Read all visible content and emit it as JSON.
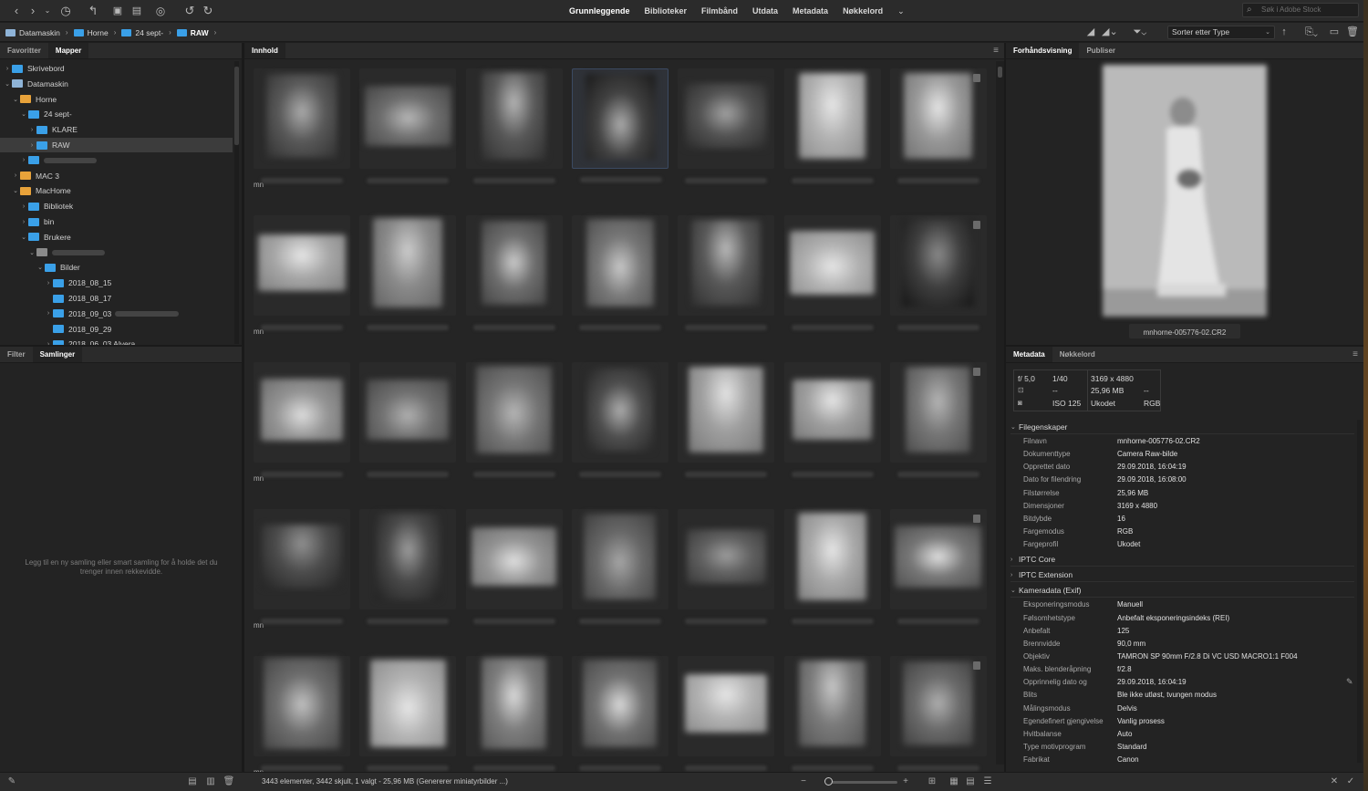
{
  "topbar": {
    "workspaces": [
      "Grunnleggende",
      "Biblioteker",
      "Filmbånd",
      "Utdata",
      "Metadata",
      "Nøkkelord"
    ],
    "active_workspace": "Grunnleggende",
    "search_placeholder": "Søk i Adobe Stock"
  },
  "pathbar": {
    "crumbs": [
      {
        "label": "Datamaskin",
        "icon": "computer-icon"
      },
      {
        "label": "Horne",
        "icon": "folder-icon"
      },
      {
        "label": "24 sept-",
        "icon": "folder-icon"
      },
      {
        "label": "RAW",
        "icon": "folder-icon"
      }
    ],
    "sort_label": "Sorter etter Type"
  },
  "folders_panel": {
    "tabs": [
      "Favoritter",
      "Mapper"
    ],
    "active_tab": "Mapper",
    "tree": [
      {
        "label": "Skrivebord",
        "level": 0,
        "icon": "folder-icon",
        "arrow": "right"
      },
      {
        "label": "Datamaskin",
        "level": 0,
        "icon": "computer-icon",
        "arrow": "down"
      },
      {
        "label": "Horne",
        "level": 1,
        "icon": "drive-icon",
        "arrow": "down"
      },
      {
        "label": "24 sept-",
        "level": 2,
        "icon": "folder-icon",
        "arrow": "down"
      },
      {
        "label": "KLARE",
        "level": 3,
        "icon": "folder-icon",
        "arrow": "right"
      },
      {
        "label": "RAW",
        "level": 3,
        "icon": "folder-icon",
        "arrow": "right",
        "selected": true
      },
      {
        "label": "",
        "level": 2,
        "icon": "folder-icon",
        "arrow": "right",
        "redacted": true
      },
      {
        "label": "MAC 3",
        "level": 1,
        "icon": "drive-icon",
        "arrow": "right"
      },
      {
        "label": "MacHome",
        "level": 1,
        "icon": "drive-icon",
        "arrow": "down"
      },
      {
        "label": "Bibliotek",
        "level": 2,
        "icon": "folder-icon",
        "arrow": "right"
      },
      {
        "label": "bin",
        "level": 2,
        "icon": "folder-icon",
        "arrow": "right"
      },
      {
        "label": "Brukere",
        "level": 2,
        "icon": "folder-icon",
        "arrow": "down"
      },
      {
        "label": "",
        "level": 3,
        "icon": "home-icon",
        "arrow": "down",
        "redacted": true
      },
      {
        "label": "Bilder",
        "level": 4,
        "icon": "folder-icon",
        "arrow": "down"
      },
      {
        "label": "2018_08_15",
        "level": 5,
        "icon": "folder-icon",
        "arrow": "right"
      },
      {
        "label": "2018_08_17",
        "level": 5,
        "icon": "folder-icon",
        "arrow": ""
      },
      {
        "label": "2018_09_03",
        "level": 5,
        "icon": "folder-icon",
        "arrow": "right",
        "redact_after": true
      },
      {
        "label": "2018_09_29",
        "level": 5,
        "icon": "folder-icon",
        "arrow": ""
      },
      {
        "label": "2018_06_03 Alvera",
        "level": 5,
        "icon": "folder-icon",
        "arrow": "right"
      }
    ]
  },
  "collections_panel": {
    "tabs": [
      "Filter",
      "Samlinger"
    ],
    "active_tab": "Samlinger",
    "empty_message": "Legg til en ny samling eller smart samling for å holde det du trenger innen rekkevidde."
  },
  "content_panel": {
    "tab": "Innhold",
    "row_prefix": "mn",
    "status": "3443 elementer, 3442 skjult, 1 valgt - 25,96 MB (Genererer miniatyrbilder ...)"
  },
  "preview_panel": {
    "tabs": [
      "Forhåndsvisning",
      "Publiser"
    ],
    "active_tab": "Forhåndsvisning",
    "filename": "mnhorne-005776-02.CR2"
  },
  "metadata_panel": {
    "tabs": [
      "Metadata",
      "Nøkkelord"
    ],
    "active_tab": "Metadata",
    "summary": {
      "aperture": "f/ 5,0",
      "shutter": "1/40",
      "dash1": "--",
      "iso": "ISO 125",
      "dimensions": "3169 x 4880",
      "size": "25,96 MB",
      "dash2": "--",
      "profile": "Ukodet",
      "mode": "RGB"
    },
    "sections": [
      {
        "title": "Filegenskaper",
        "expanded": true,
        "rows": [
          {
            "k": "Filnavn",
            "v": "mnhorne-005776-02.CR2"
          },
          {
            "k": "Dokumenttype",
            "v": "Camera Raw-bilde"
          },
          {
            "k": "Opprettet dato",
            "v": "29.09.2018, 16:04:19"
          },
          {
            "k": "Dato for filendring",
            "v": "29.09.2018, 16:08:00"
          },
          {
            "k": "Filstørrelse",
            "v": "25,96 MB"
          },
          {
            "k": "Dimensjoner",
            "v": "3169 x 4880"
          },
          {
            "k": "Bitdybde",
            "v": "16"
          },
          {
            "k": "Fargemodus",
            "v": "RGB"
          },
          {
            "k": "Fargeprofil",
            "v": "Ukodet"
          }
        ]
      },
      {
        "title": "IPTC Core",
        "expanded": false,
        "rows": []
      },
      {
        "title": "IPTC Extension",
        "expanded": false,
        "rows": []
      },
      {
        "title": "Kameradata (Exif)",
        "expanded": true,
        "rows": [
          {
            "k": "Eksponeringsmodus",
            "v": "Manuell"
          },
          {
            "k": "Følsomhetstype",
            "v": "Anbefalt eksponeringsindeks (REI)"
          },
          {
            "k": "Anbefalt",
            "v": "125"
          },
          {
            "k": "Brennvidde",
            "v": "90,0 mm"
          },
          {
            "k": "Objektiv",
            "v": "TAMRON SP 90mm F/2.8 Di VC USD MACRO1:1 F004"
          },
          {
            "k": "Maks. blenderåpning",
            "v": "f/2.8"
          },
          {
            "k": "Opprinnelig dato og",
            "v": "29.09.2018, 16:04:19"
          },
          {
            "k": "Blits",
            "v": "Ble ikke utløst, tvungen modus"
          },
          {
            "k": "Målingsmodus",
            "v": "Delvis"
          },
          {
            "k": "Egendefinert gjengivelse",
            "v": "Vanlig prosess"
          },
          {
            "k": "Hvitbalanse",
            "v": "Auto"
          },
          {
            "k": "Type motivprogram",
            "v": "Standard"
          },
          {
            "k": "Fabrikat",
            "v": "Canon"
          }
        ]
      }
    ]
  },
  "colors": {
    "background": "#1e1e1e",
    "panel": "#232323",
    "bar": "#2b2b2b",
    "folder_blue": "#3aa0e8",
    "drive_orange": "#e8a23a",
    "selection": "#3c3c3c"
  }
}
